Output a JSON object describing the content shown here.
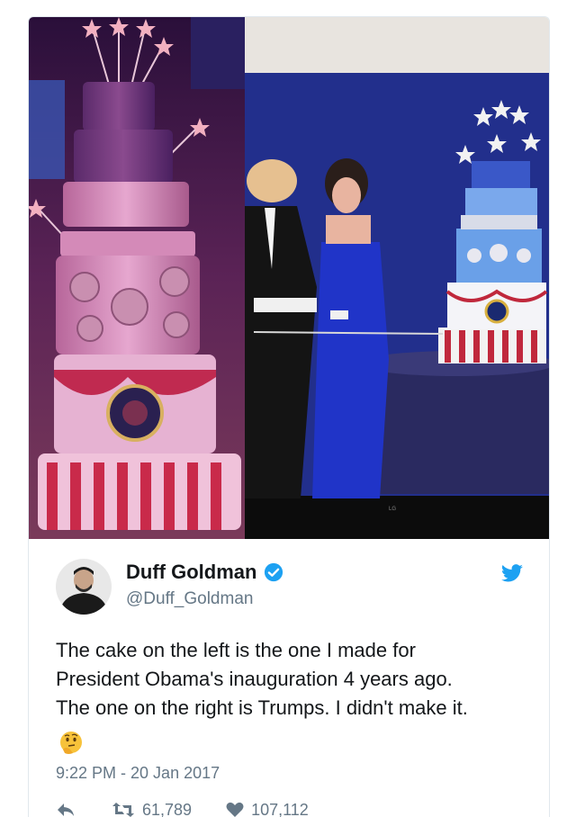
{
  "tweet": {
    "display_name": "Duff Goldman",
    "handle": "@Duff_Goldman",
    "verified": true,
    "text_lines": [
      "The cake on the left is the one I made for",
      "President Obama's inauguration 4 years ago.",
      "The one on the right is Trumps. I didn't make it."
    ],
    "emoji": "thinking-face",
    "timestamp": "9:22 PM - 20 Jan 2017",
    "retweets": "61,789",
    "likes": "107,112",
    "tv_brand": "LG"
  },
  "colors": {
    "text": "#14171a",
    "secondary": "#657786",
    "twitter_blue": "#1da1f2",
    "border": "#e1e8ed"
  },
  "icons": {
    "reply": "reply-icon",
    "retweet": "retweet-icon",
    "like": "heart-icon",
    "brand": "twitter-bird-icon",
    "verified": "verified-badge-icon"
  }
}
